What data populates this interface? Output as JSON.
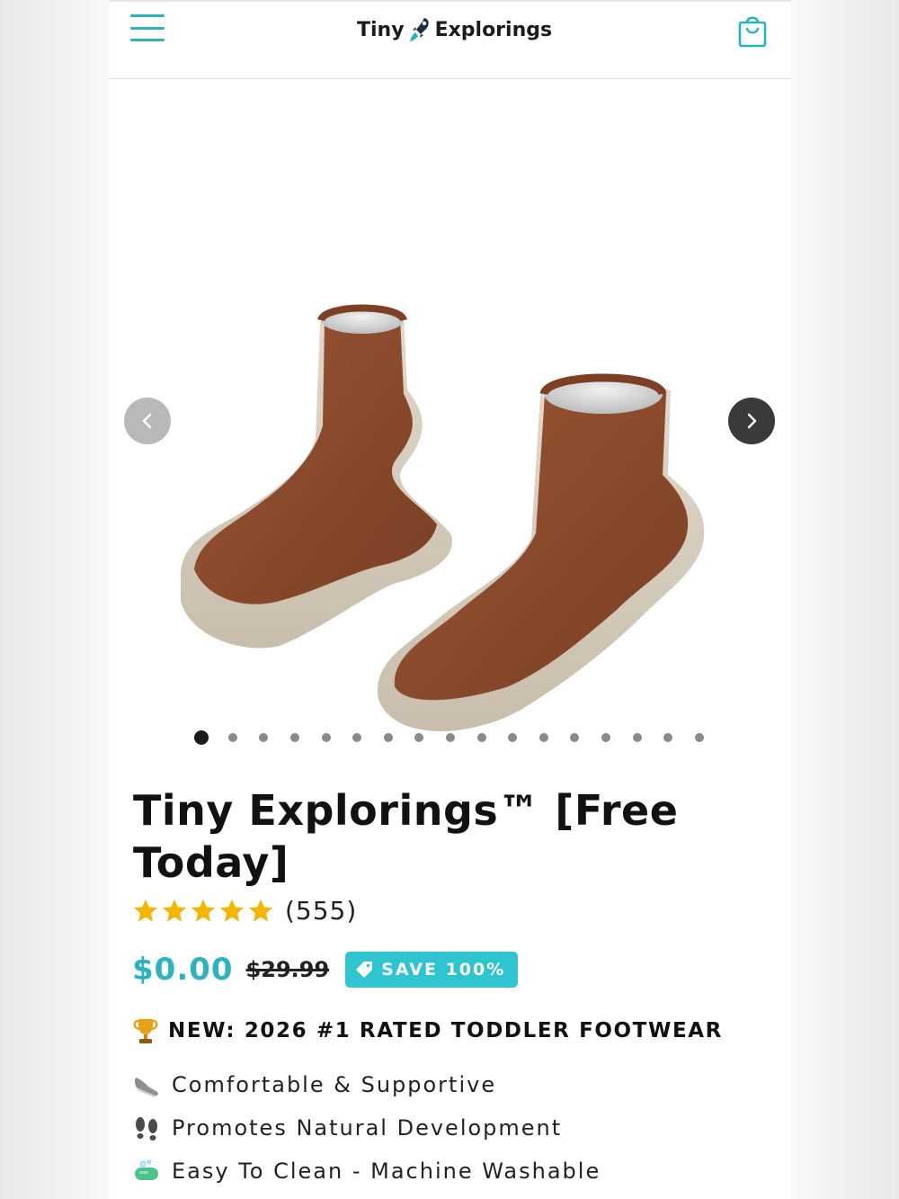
{
  "header": {
    "menu_icon": "hamburger-menu-icon",
    "logo_left": "Tiny",
    "logo_right": "Explorings",
    "logo_icon": "rocket-icon",
    "cart_icon": "shopping-bag-icon"
  },
  "gallery": {
    "slide_count": 17,
    "active_slide": 1,
    "prev_icon": "chevron-left-icon",
    "next_icon": "chevron-right-icon"
  },
  "product": {
    "title": "Tiny Explorings™ [Free Today]",
    "rating_stars": 5,
    "review_count": "(555)",
    "price": "$0.00",
    "compare_price": "$29.99",
    "save_badge": "SAVE 100%"
  },
  "headline": {
    "icon": "trophy-icon",
    "text": "NEW: 2026 #1 RATED TODDLER FOOTWEAR"
  },
  "features": [
    {
      "icon": "sneaker-icon",
      "text": "Comfortable & Supportive"
    },
    {
      "icon": "footprints-icon",
      "text": "Promotes Natural Development"
    },
    {
      "icon": "soap-icon",
      "text": "Easy To Clean - Machine Washable"
    }
  ],
  "colors": {
    "accent": "#2bb3c0",
    "badge": "#2ec4d0",
    "star": "#f2b705",
    "sock": "#8a4a2b",
    "sole": "#d9cfc0"
  }
}
